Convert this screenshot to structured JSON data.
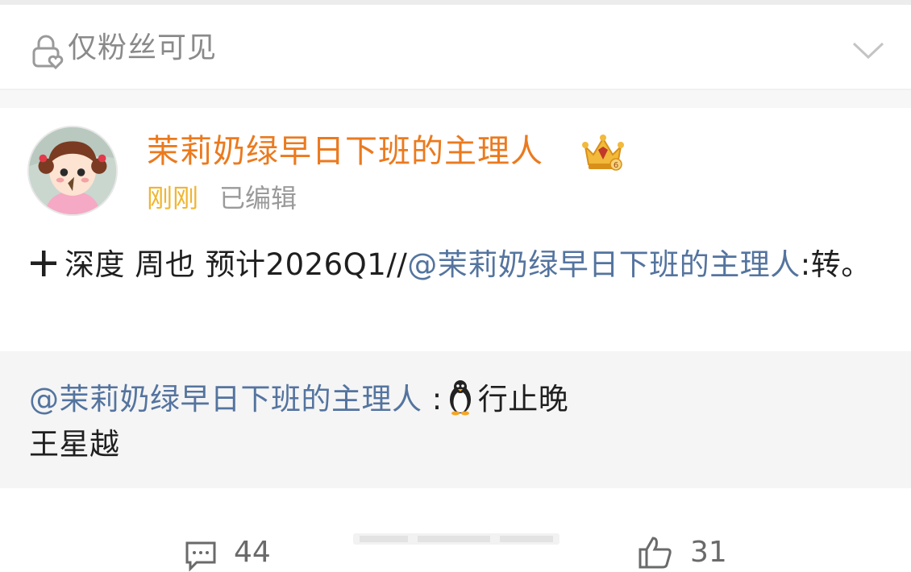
{
  "visibility": {
    "label": "仅粉丝可见"
  },
  "post": {
    "author": "茉莉奶绿早日下班的主理人",
    "time": "刚刚",
    "edited": "已编辑",
    "content": {
      "text": "深度 周也  预计2026Q1//",
      "mention": "@茉莉奶绿早日下班的主理人",
      "tail": ":转。"
    },
    "quote": {
      "mention": "@茉莉奶绿早日下班的主理人",
      "colon": " :",
      "line1": "行止晚",
      "line2": "王星越"
    },
    "actions": {
      "comments": "44",
      "likes": "31"
    }
  },
  "colors": {
    "username": "#eb7a1e",
    "time": "#f0b530",
    "mention": "#54749f",
    "quote_bg": "#f5f5f5"
  },
  "icons": [
    "lock-heart-icon",
    "chevron-down-icon",
    "crown-badge-icon",
    "plus-icon",
    "penguin-icon",
    "comment-icon",
    "like-icon"
  ]
}
